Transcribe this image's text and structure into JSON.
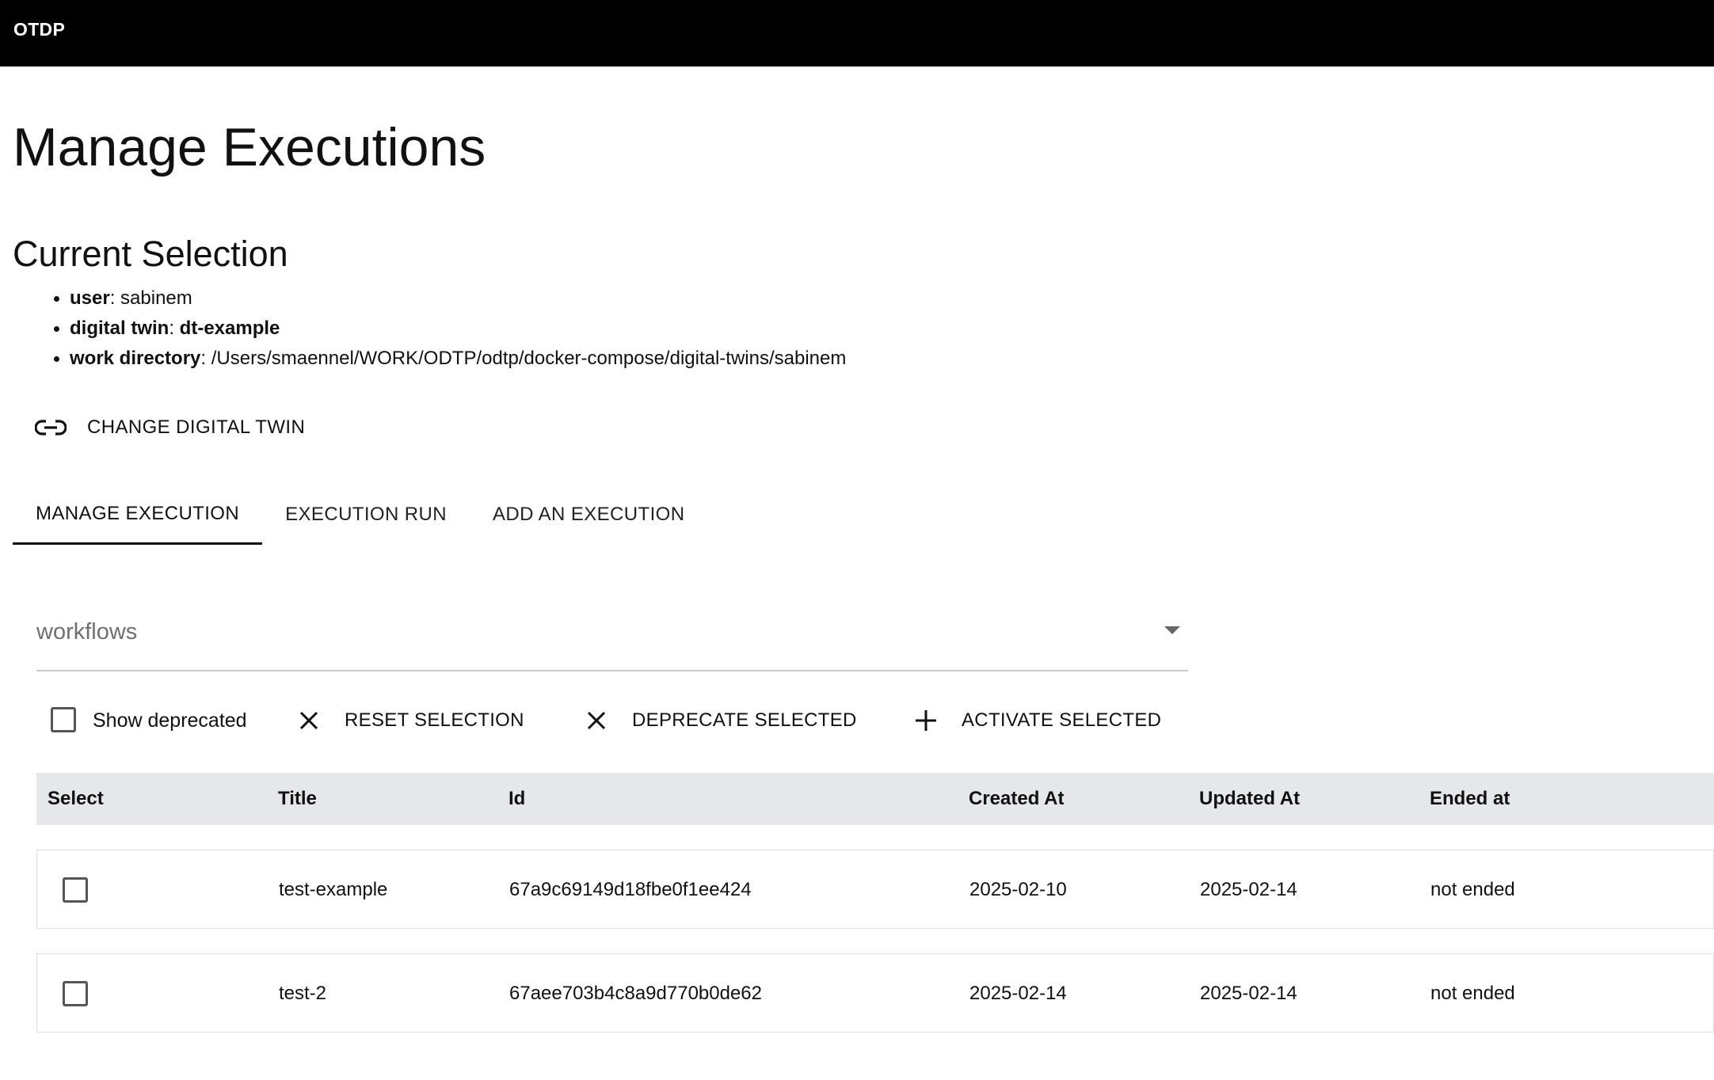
{
  "app": {
    "title": "OTDP"
  },
  "page": {
    "title": "Manage Executions"
  },
  "selection": {
    "title": "Current Selection",
    "items": [
      {
        "key": "user",
        "sep": ": ",
        "value": "sabinem",
        "value_bold": false
      },
      {
        "key": "digital twin",
        "sep": ": ",
        "value": "dt-example",
        "value_bold": true
      },
      {
        "key": "work directory",
        "sep": ": ",
        "value": "/Users/smaennel/WORK/ODTP/odtp/docker-compose/digital-twins/sabinem",
        "value_bold": false
      }
    ]
  },
  "change_button": {
    "label": "CHANGE DIGITAL TWIN",
    "icon": "link-icon"
  },
  "tabs": [
    {
      "label": "MANAGE EXECUTION",
      "active": true
    },
    {
      "label": "EXECUTION RUN",
      "active": false
    },
    {
      "label": "ADD AN EXECUTION",
      "active": false
    }
  ],
  "filter": {
    "label": "workflows",
    "icon": "dropdown-caret-icon"
  },
  "toolbar": {
    "show_deprecated": {
      "label": "Show deprecated",
      "checked": false
    },
    "reset": {
      "label": "RESET SELECTION",
      "icon": "close-icon"
    },
    "deprecate": {
      "label": "DEPRECATE SELECTED",
      "icon": "close-icon"
    },
    "activate": {
      "label": "ACTIVATE SELECTED",
      "icon": "plus-icon"
    }
  },
  "table": {
    "columns": [
      "Select",
      "Title",
      "Id",
      "Created At",
      "Updated At",
      "Ended at"
    ],
    "rows": [
      {
        "title": "test-example",
        "id": "67a9c69149d18fbe0f1ee424",
        "created": "2025-02-10",
        "updated": "2025-02-14",
        "ended": "not ended",
        "selected": false
      },
      {
        "title": "test-2",
        "id": "67aee703b4c8a9d770b0de62",
        "created": "2025-02-14",
        "updated": "2025-02-14",
        "ended": "not ended",
        "selected": false
      }
    ]
  },
  "colors": {
    "topbar": "#000000",
    "table_header": "#e5e7eb",
    "text": "#111111",
    "muted": "#6f6f6f"
  }
}
